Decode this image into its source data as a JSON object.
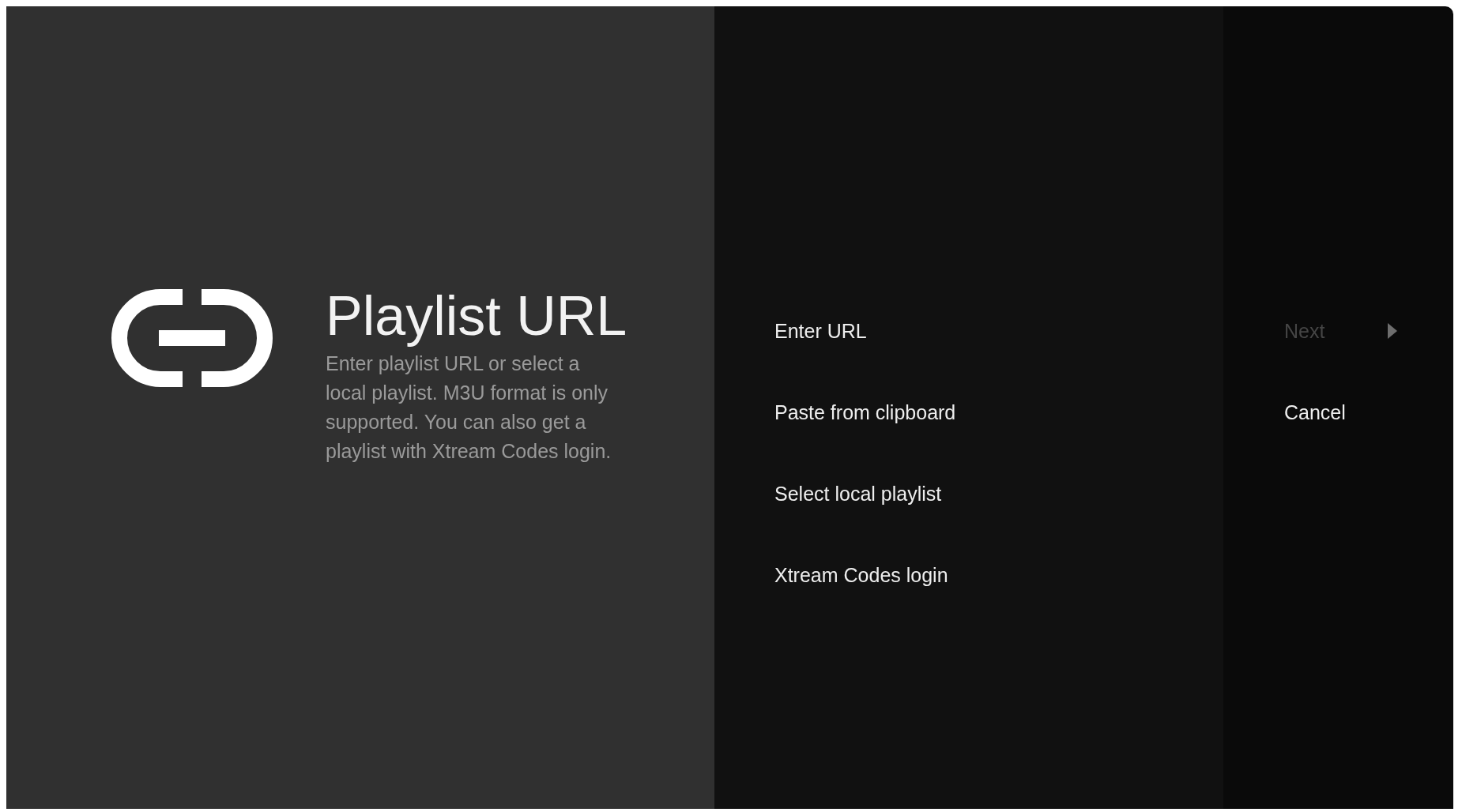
{
  "guidance": {
    "title": "Playlist URL",
    "description": "Enter playlist URL or select a local playlist. M3U format is only supported. You can also get a playlist with Xtream Codes login."
  },
  "options": [
    {
      "label": "Enter URL"
    },
    {
      "label": "Paste from clipboard"
    },
    {
      "label": "Select local playlist"
    },
    {
      "label": "Xtream Codes login"
    }
  ],
  "actions": [
    {
      "label": "Next",
      "disabled": true,
      "kind": "next"
    },
    {
      "label": "Cancel",
      "disabled": false,
      "kind": "plain"
    }
  ]
}
